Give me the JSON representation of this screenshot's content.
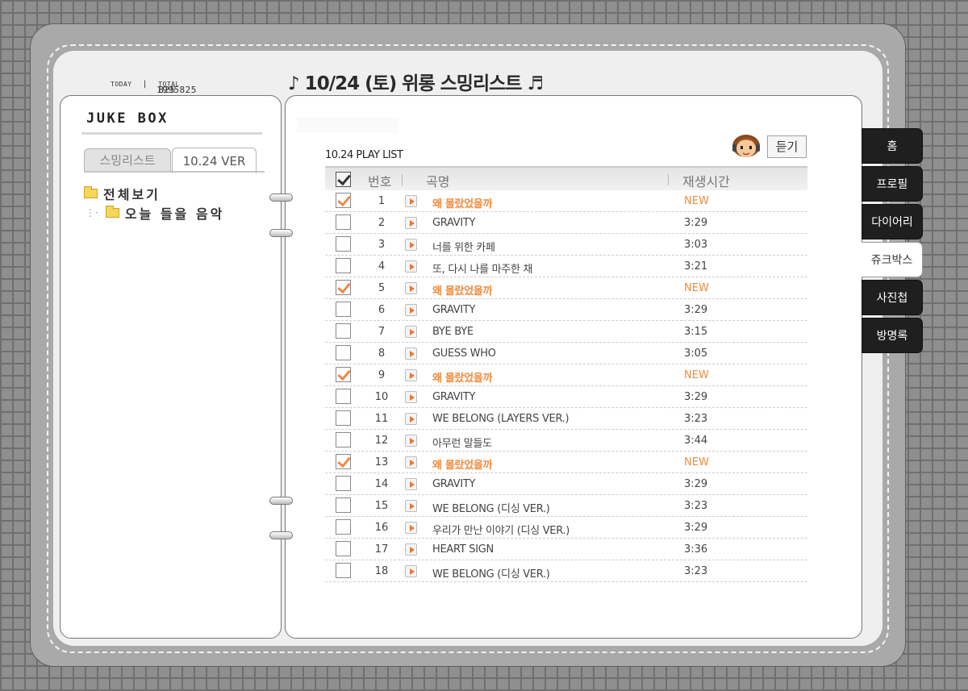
{
  "counter": {
    "today_label": "TODAY",
    "today": "825",
    "divider": "|",
    "total_label": "TOTAL",
    "total": "1995825"
  },
  "header": {
    "title": "♪ 10/24 (토) 위롱 스밍리스트 ♬"
  },
  "sidebar": {
    "title": "JUKE BOX",
    "tabs": [
      {
        "label": "스밍리스트"
      },
      {
        "label": "10.24 VER"
      }
    ],
    "tree": [
      {
        "label": "전체보기"
      },
      {
        "label": "오늘 들을 음악",
        "prefix": "⋮·"
      }
    ]
  },
  "playlist": {
    "title": "10.24 PLAY LIST",
    "listen_label": "듣기",
    "columns": {
      "number": "번호",
      "song": "곡명",
      "duration": "재생시간"
    },
    "rows": [
      {
        "n": "1",
        "song": "왜 몰랐었을까",
        "time": "NEW",
        "checked": true
      },
      {
        "n": "2",
        "song": "GRAVITY",
        "time": "3:29",
        "checked": false
      },
      {
        "n": "3",
        "song": "너를 위한 카페",
        "time": "3:03",
        "checked": false
      },
      {
        "n": "4",
        "song": "또, 다시 나를 마주한 채",
        "time": "3:21",
        "checked": false
      },
      {
        "n": "5",
        "song": "왜 몰랐었을까",
        "time": "NEW",
        "checked": true
      },
      {
        "n": "6",
        "song": "GRAVITY",
        "time": "3:29",
        "checked": false
      },
      {
        "n": "7",
        "song": "BYE BYE",
        "time": "3:15",
        "checked": false
      },
      {
        "n": "8",
        "song": "GUESS WHO",
        "time": "3:05",
        "checked": false
      },
      {
        "n": "9",
        "song": "왜 몰랐었을까",
        "time": "NEW",
        "checked": true
      },
      {
        "n": "10",
        "song": "GRAVITY",
        "time": "3:29",
        "checked": false
      },
      {
        "n": "11",
        "song": "WE BELONG (LAYERS VER.)",
        "time": "3:23",
        "checked": false
      },
      {
        "n": "12",
        "song": "아무런 말들도",
        "time": "3:44",
        "checked": false
      },
      {
        "n": "13",
        "song": "왜 몰랐었을까",
        "time": "NEW",
        "checked": true
      },
      {
        "n": "14",
        "song": "GRAVITY",
        "time": "3:29",
        "checked": false
      },
      {
        "n": "15",
        "song": "WE BELONG (디싱 VER.)",
        "time": "3:23",
        "checked": false
      },
      {
        "n": "16",
        "song": "우리가 만난 이야기 (디싱 VER.)",
        "time": "3:29",
        "checked": false
      },
      {
        "n": "17",
        "song": "HEART SIGN",
        "time": "3:36",
        "checked": false
      },
      {
        "n": "18",
        "song": "WE BELONG (디싱 VER.)",
        "time": "3:23",
        "checked": false
      }
    ]
  },
  "nav": [
    {
      "label": "홈",
      "active": false
    },
    {
      "label": "프로필",
      "active": false
    },
    {
      "label": "다이어리",
      "active": false
    },
    {
      "label": "쥬크박스",
      "active": true
    },
    {
      "label": "사진첩",
      "active": false
    },
    {
      "label": "방명록",
      "active": false
    }
  ],
  "colors": {
    "accent": "#ef8a3b",
    "nav_bg": "#1f1f1f",
    "frame": "#a9a9a9"
  }
}
